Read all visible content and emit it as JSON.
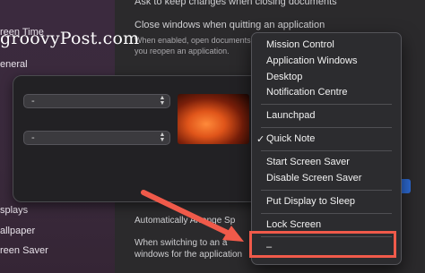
{
  "sidebar": {
    "items": [
      {
        "label": "reen Time"
      },
      {
        "label": "eneral"
      },
      {
        "label": "splays"
      },
      {
        "label": "allpaper"
      },
      {
        "label": "reen Saver"
      }
    ]
  },
  "settings": {
    "top_line": "Ask to keep changes when closing documents",
    "close_windows": "Close windows when quitting an application",
    "close_desc_1": "When enabled, open documents",
    "close_desc_2": "you reopen an application.",
    "auto_arrange": "Automatically Arrange Sp",
    "switching_1": "When switching to an a",
    "switching_2": "windows for the application"
  },
  "watermark": "groovyPost.com",
  "panel": {
    "select_top": "-",
    "select_bottom": "-",
    "select_right": "-"
  },
  "menu": {
    "items": [
      "Mission Control",
      "Application Windows",
      "Desktop",
      "Notification Centre",
      "Launchpad",
      "Quick Note",
      "Start Screen Saver",
      "Disable Screen Saver",
      "Put Display to Sleep",
      "Lock Screen",
      "–"
    ],
    "checked": "✓"
  },
  "colors": {
    "highlight": "#f05a4a",
    "arrow": "#f05a4a",
    "accent": "#2d6bd6"
  }
}
